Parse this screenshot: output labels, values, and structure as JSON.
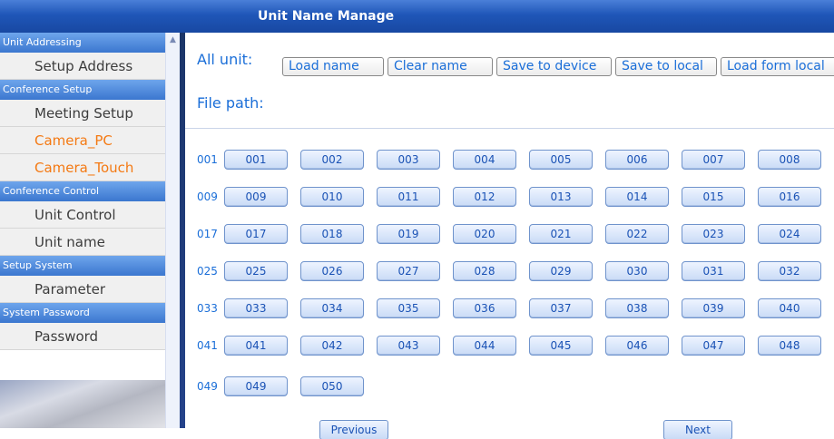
{
  "title": "Unit Name Manage",
  "sidebar": {
    "sections": [
      {
        "header": "Unit Addressing",
        "items": [
          {
            "label": "Setup Address",
            "color": "#3c3c3c"
          }
        ]
      },
      {
        "header": "Conference Setup",
        "items": [
          {
            "label": "Meeting Setup",
            "color": "#3c3c3c"
          },
          {
            "label": "Camera_PC",
            "color": "#f47a14"
          },
          {
            "label": "Camera_Touch",
            "color": "#f47a14"
          }
        ]
      },
      {
        "header": "Conference Control",
        "items": [
          {
            "label": "Unit Control",
            "color": "#3c3c3c"
          },
          {
            "label": "Unit name",
            "color": "#3c3c3c"
          }
        ]
      },
      {
        "header": "Setup System",
        "items": [
          {
            "label": "Parameter",
            "color": "#3c3c3c"
          }
        ]
      },
      {
        "header": "System Password",
        "items": [
          {
            "label": "Password",
            "color": "#3c3c3c"
          }
        ]
      }
    ]
  },
  "toolbar": {
    "all_unit_label": "All unit:",
    "buttons": [
      "Load name",
      "Clear name",
      "Save to device",
      "Save to local",
      "Load form local"
    ],
    "file_path_label": "File path:"
  },
  "units": {
    "rows": [
      {
        "label": "001",
        "buttons": [
          "001",
          "002",
          "003",
          "004",
          "005",
          "006",
          "007",
          "008"
        ]
      },
      {
        "label": "009",
        "buttons": [
          "009",
          "010",
          "011",
          "012",
          "013",
          "014",
          "015",
          "016"
        ]
      },
      {
        "label": "017",
        "buttons": [
          "017",
          "018",
          "019",
          "020",
          "021",
          "022",
          "023",
          "024"
        ]
      },
      {
        "label": "025",
        "buttons": [
          "025",
          "026",
          "027",
          "028",
          "029",
          "030",
          "031",
          "032"
        ]
      },
      {
        "label": "033",
        "buttons": [
          "033",
          "034",
          "035",
          "036",
          "037",
          "038",
          "039",
          "040"
        ]
      },
      {
        "label": "041",
        "buttons": [
          "041",
          "042",
          "043",
          "044",
          "045",
          "046",
          "047",
          "048"
        ]
      },
      {
        "label": "049",
        "buttons": [
          "049",
          "050"
        ]
      }
    ]
  },
  "pagination": {
    "previous": "Previous",
    "next": "Next"
  },
  "colors": {
    "accent_blue": "#1a6ed8",
    "title_bar": "#1f56b8",
    "sidebar_header": "#3b77cf",
    "highlight_orange": "#f47a14"
  }
}
